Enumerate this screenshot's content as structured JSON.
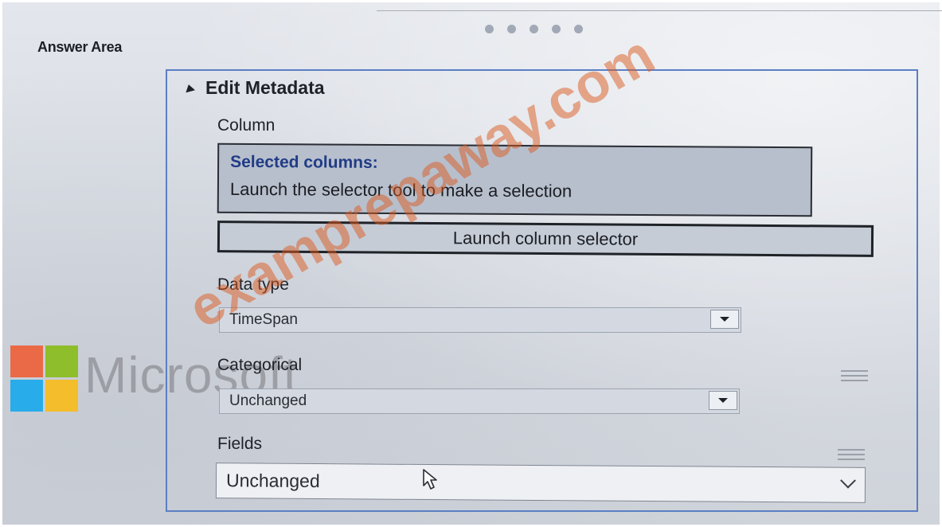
{
  "header": {
    "answer_area": "Answer Area",
    "pager_dots": 5
  },
  "panel": {
    "title": "Edit Metadata",
    "column": {
      "label": "Column",
      "selected_title": "Selected columns:",
      "selected_hint": "Launch the selector tool to make a selection",
      "launch_button": "Launch column selector"
    },
    "data_type": {
      "label": "Data type",
      "value": "TimeSpan"
    },
    "categorical": {
      "label": "Categorical",
      "value": "Unchanged"
    },
    "fields": {
      "label": "Fields",
      "value": "Unchanged"
    }
  },
  "overlay": {
    "logo_text": "Microsoft",
    "watermark": "examprepaway.com"
  },
  "colors": {
    "panel_border": "#5a7fc4",
    "selected_title": "#213c86",
    "logo_red": "#f25022",
    "logo_green": "#7fba00",
    "logo_blue": "#00a4ef",
    "logo_yellow": "#ffb900"
  },
  "icons": {
    "collapse": "triangle-up-icon",
    "dropdown": "caret-down-icon",
    "fields_dropdown": "chevron-down-icon",
    "drag_handle": "hamburger-icon",
    "cursor": "mouse-pointer-icon"
  }
}
